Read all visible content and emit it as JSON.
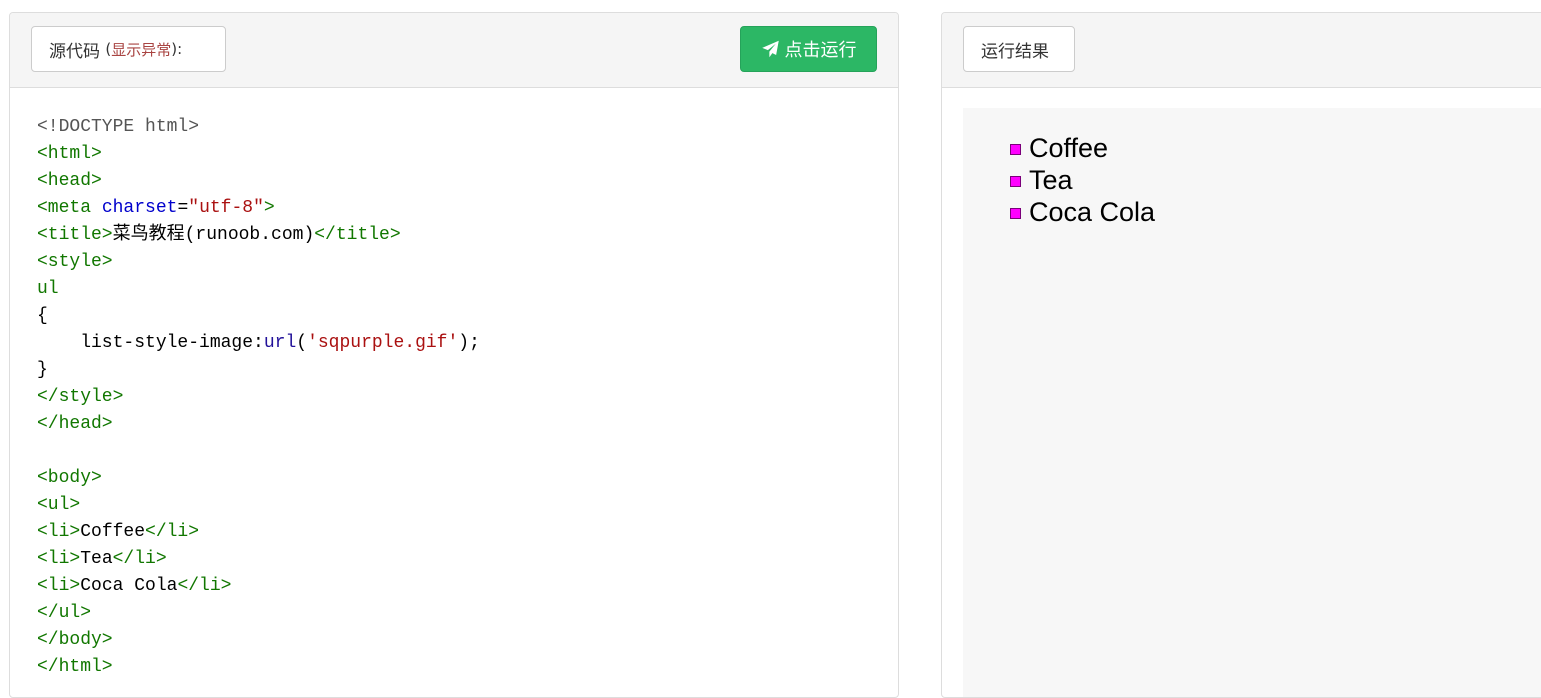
{
  "editor": {
    "source_label": "源代码",
    "paren_open": "(",
    "error_link": "显示异常",
    "paren_close": "):",
    "run_button": "点击运行",
    "code": {
      "doctype": "<!DOCTYPE html>",
      "html_open": "<html>",
      "head_open": "<head>",
      "meta_open": "<meta",
      "meta_attr": "charset",
      "meta_eq": "=",
      "meta_value": "\"utf-8\"",
      "meta_close": ">",
      "title_open": "<title>",
      "title_text": "菜鸟教程(runoob.com)",
      "title_close": "</title>",
      "style_open": "<style>",
      "selector": "ul",
      "brace_open": "{",
      "prop_indent": "    list-style-image:",
      "prop_fn": "url",
      "prop_paren_open": "(",
      "prop_value": "'sqpurple.gif'",
      "prop_end": ");",
      "brace_close": "}",
      "style_close": "</style>",
      "head_close": "</head>",
      "body_open": "<body>",
      "ul_open": "<ul>",
      "li_open": "<li>",
      "li_close": "</li>",
      "item1": "Coffee",
      "item2": "Tea",
      "item3": "Coca Cola",
      "ul_close": "</ul>",
      "body_close": "</body>",
      "html_close": "</html>"
    }
  },
  "result": {
    "label": "运行结果",
    "items": [
      "Coffee",
      "Tea",
      "Coca Cola"
    ],
    "bullet_color": "#ff00ff"
  },
  "colors": {
    "run_button": "#2cb765",
    "error_link": "#a94442",
    "code_tag": "#117700",
    "code_attr": "#0000cc",
    "code_string": "#aa1111"
  }
}
